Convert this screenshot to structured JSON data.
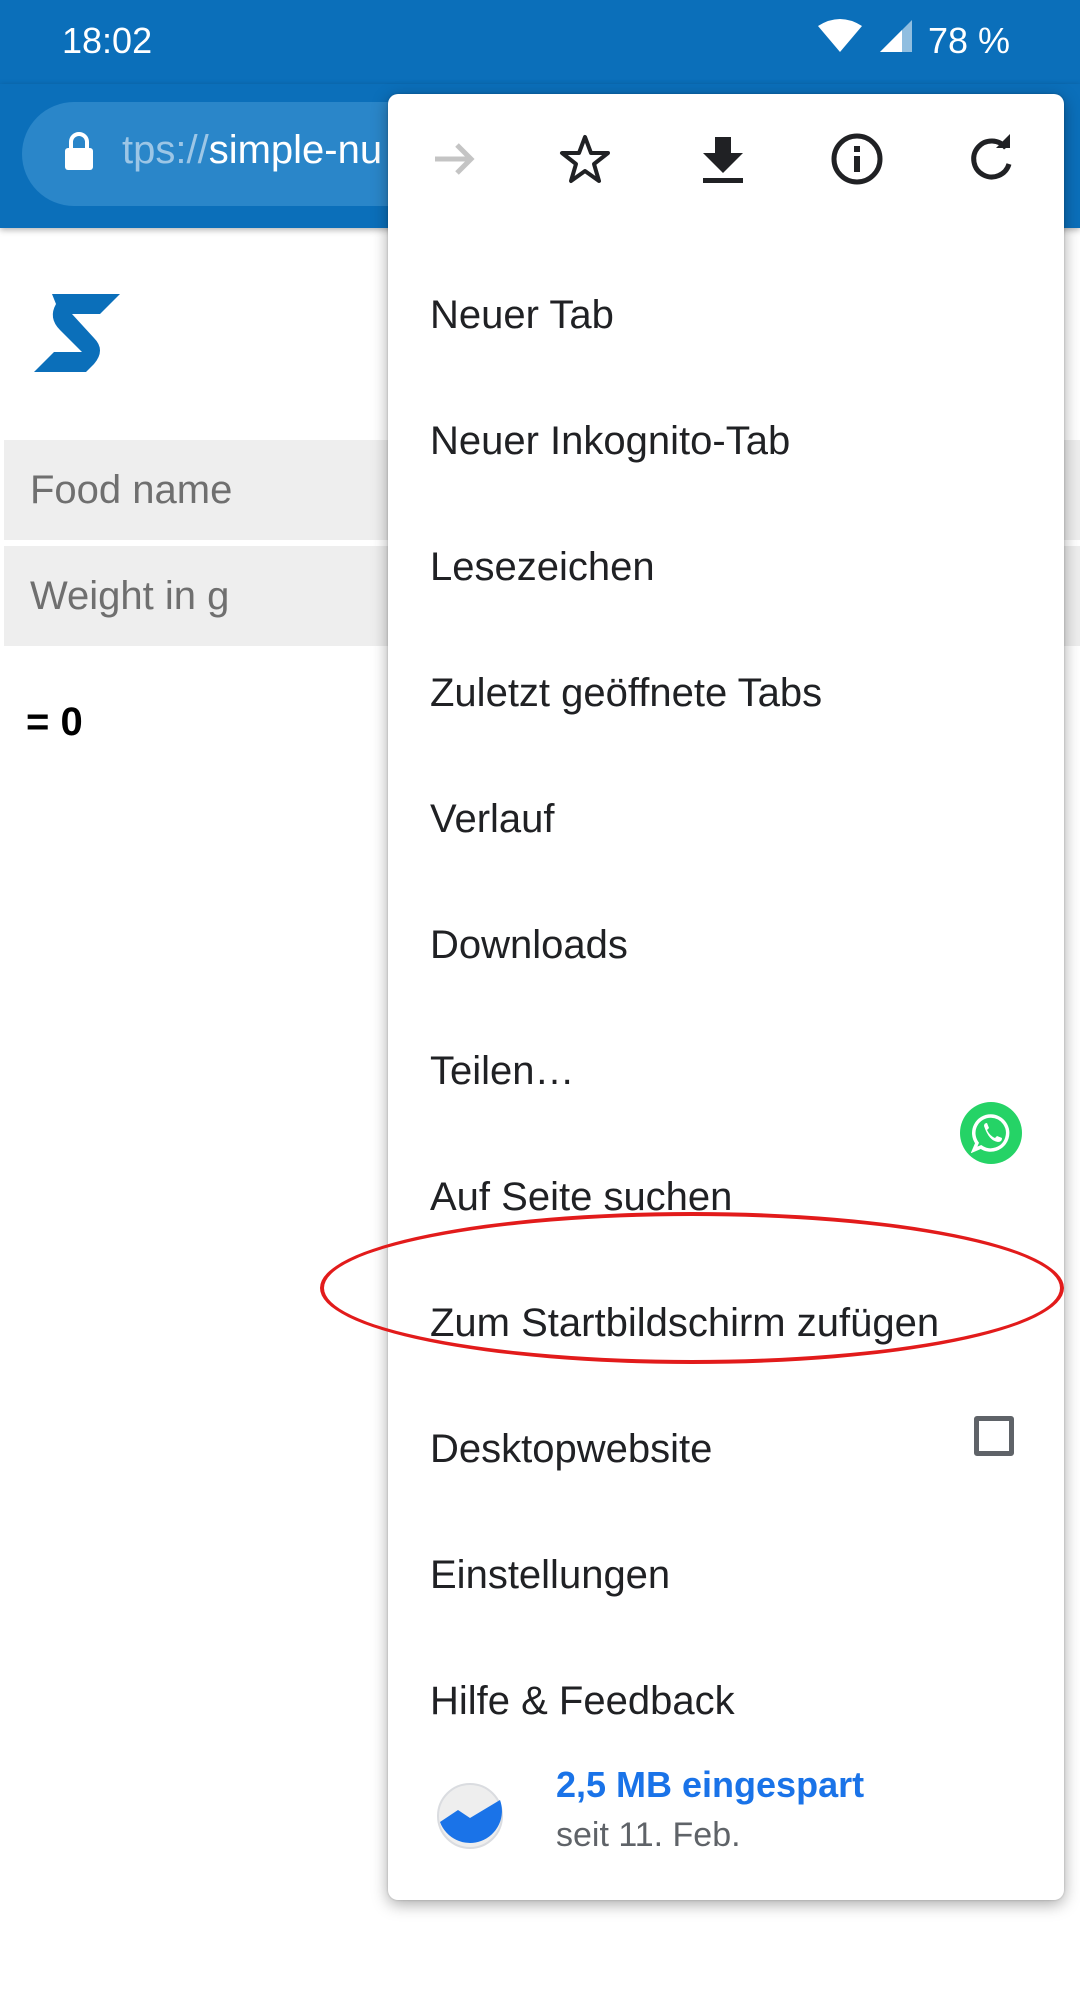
{
  "status_bar": {
    "time": "18:02",
    "battery": "78 %"
  },
  "browser": {
    "url_dim": "tps://",
    "url_main": "simple-nu"
  },
  "page": {
    "food_placeholder": "Food name",
    "weight_placeholder": "Weight in g",
    "result": "= 0"
  },
  "menu": {
    "items": [
      "Neuer Tab",
      "Neuer Inkognito-Tab",
      "Lesezeichen",
      "Zuletzt geöffnete Tabs",
      "Verlauf",
      "Downloads",
      "Teilen…",
      "Auf Seite suchen",
      "Zum Startbildschirm zufügen",
      "Desktopwebsite",
      "Einstellungen",
      "Hilfe & Feedback"
    ],
    "savings_amount": "2,5 MB eingespart",
    "savings_since": "seit 11. Feb."
  },
  "colors": {
    "brand": "#0b6fba",
    "highlight": "#e21b1b",
    "link": "#1a73e8"
  }
}
